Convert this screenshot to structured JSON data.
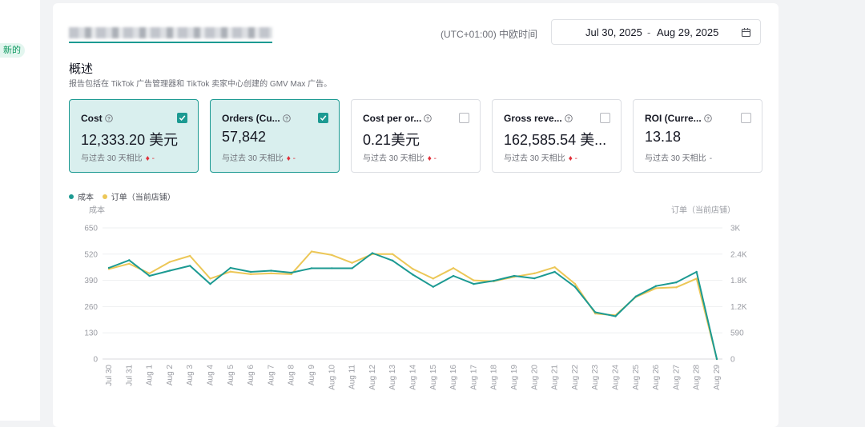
{
  "sidebar": {
    "badge": "新的"
  },
  "header": {
    "timezone_label": "(UTC+01:00) 中欧时间",
    "date_start": "Jul 30, 2025",
    "date_separator": "-",
    "date_end": "Aug 29, 2025",
    "calendar_icon": "calendar-icon"
  },
  "overview": {
    "title": "概述",
    "description": "报告包括在 TikTok 广告管理器和 TikTok 卖家中心创建的 GMV Max 广告。"
  },
  "metrics": [
    {
      "name": "Cost",
      "value": "12,333.20 美元",
      "compare": "与过去 30 天相比",
      "delta": "♦ -",
      "selected": true
    },
    {
      "name": "Orders (Cu...",
      "value": "57,842",
      "compare": "与过去 30 天相比",
      "delta": "♦ -",
      "selected": true
    },
    {
      "name": "Cost per or...",
      "value": "0.21美元",
      "compare": "与过去 30 天相比",
      "delta": "♦ -",
      "selected": false
    },
    {
      "name": "Gross reve...",
      "value": "162,585.54 美...",
      "compare": "与过去 30 天相比",
      "delta": "♦ -",
      "selected": false
    },
    {
      "name": "ROI (Curre...",
      "value": "13.18",
      "compare": "与过去 30 天相比",
      "delta": "-",
      "selected": false
    }
  ],
  "colors": {
    "accent": "#1c9a92",
    "cost_line": "#1c9a92",
    "orders_line": "#ecc757",
    "down": "#e0303a"
  },
  "chart_data": {
    "type": "line",
    "legend": [
      "成本",
      "订单（当前店铺）"
    ],
    "legend_position": "top-left",
    "grid": true,
    "y_left_label": "成本",
    "y_right_label": "订单（当前店铺）",
    "y_left_ticks": [
      "650",
      "520",
      "390",
      "260",
      "130",
      "0"
    ],
    "y_right_ticks": [
      "3K",
      "2.4K",
      "1.8K",
      "1.2K",
      "590",
      "0"
    ],
    "y_left_range": [
      0,
      650
    ],
    "y_right_range": [
      0,
      3000
    ],
    "x": [
      "Jul 30",
      "Jul 31",
      "Aug 1",
      "Aug 2",
      "Aug 3",
      "Aug 4",
      "Aug 5",
      "Aug 6",
      "Aug 7",
      "Aug 8",
      "Aug 9",
      "Aug 10",
      "Aug 11",
      "Aug 12",
      "Aug 13",
      "Aug 14",
      "Aug 15",
      "Aug 16",
      "Aug 17",
      "Aug 18",
      "Aug 19",
      "Aug 20",
      "Aug 21",
      "Aug 22",
      "Aug 23",
      "Aug 24",
      "Aug 25",
      "Aug 26",
      "Aug 27",
      "Aug 28",
      "Aug 29"
    ],
    "series": [
      {
        "name": "成本",
        "axis": "left",
        "values": [
          452,
          490,
          412,
          438,
          462,
          372,
          452,
          432,
          438,
          428,
          450,
          450,
          450,
          525,
          488,
          418,
          358,
          412,
          372,
          388,
          412,
          400,
          432,
          358,
          232,
          212,
          310,
          362,
          380,
          432,
          0
        ]
      },
      {
        "name": "订单（当前店铺）",
        "axis": "right",
        "values": [
          2060,
          2180,
          1960,
          2220,
          2360,
          1840,
          2000,
          1940,
          1960,
          1940,
          2460,
          2380,
          2200,
          2400,
          2400,
          2060,
          1840,
          2080,
          1800,
          1780,
          1880,
          1960,
          2100,
          1720,
          1040,
          1000,
          1420,
          1620,
          1640,
          1840,
          0
        ]
      }
    ]
  }
}
